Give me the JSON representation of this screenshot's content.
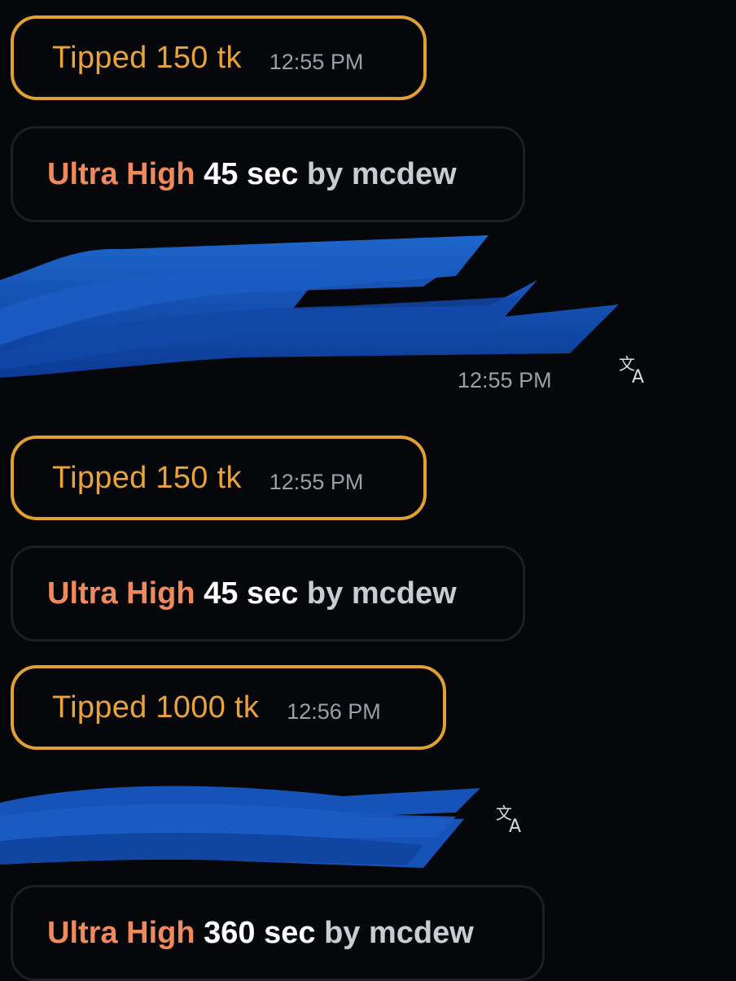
{
  "messages": [
    {
      "type": "tip",
      "text": "Tipped 150 tk",
      "time": "12:55 PM"
    },
    {
      "type": "setting",
      "level": "Ultra High",
      "duration": "45 sec",
      "by": "by mcdew"
    },
    {
      "type": "redacted",
      "time": "12:55 PM",
      "icon": "translate-icon"
    },
    {
      "type": "tip",
      "text": "Tipped 150 tk",
      "time": "12:55 PM"
    },
    {
      "type": "setting",
      "level": "Ultra High",
      "duration": "45 sec",
      "by": "by mcdew"
    },
    {
      "type": "tip",
      "text": "Tipped 1000 tk",
      "time": "12:56 PM"
    },
    {
      "type": "redacted",
      "icon": "translate-icon"
    },
    {
      "type": "setting",
      "level": "Ultra High",
      "duration": "360 sec",
      "by": "by mcdew"
    }
  ],
  "colors": {
    "background": "#05070b",
    "tip_border": "#e0a032",
    "tip_text": "#e8a43a",
    "level_text": "#f08a5d",
    "timestamp": "#9aa0a6",
    "redaction": "#1553b8"
  }
}
